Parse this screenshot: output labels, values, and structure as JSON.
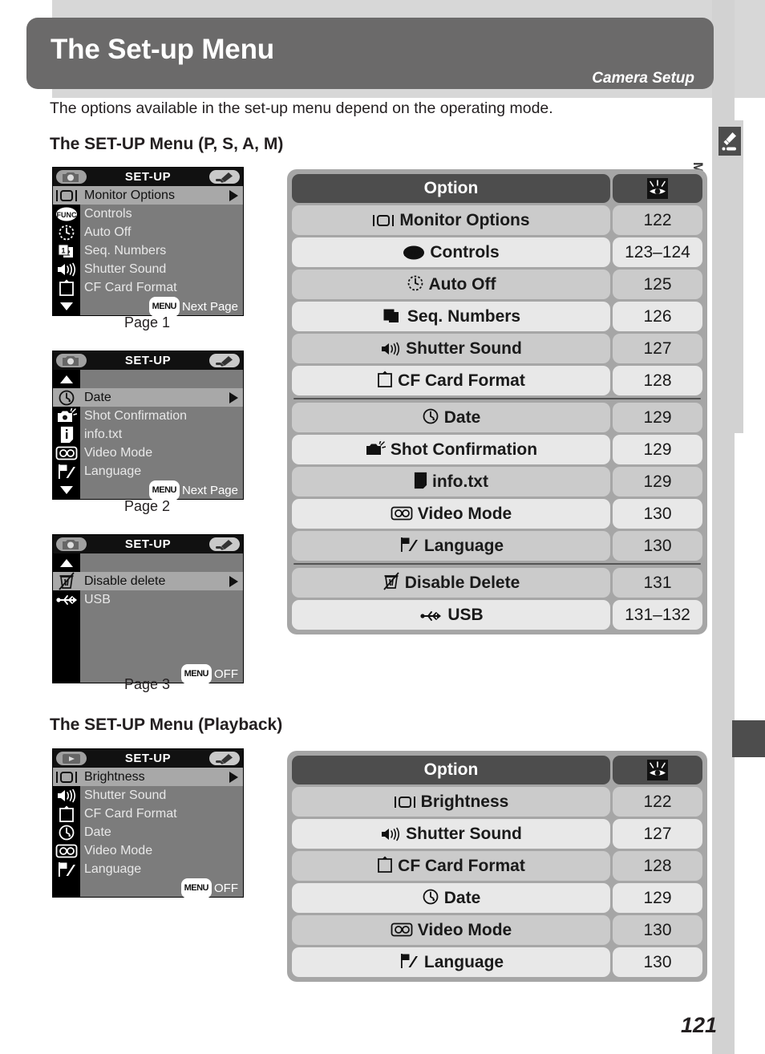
{
  "header": {
    "title": "The Set-up Menu",
    "subtitle": "Camera Setup"
  },
  "intro": "The options available in the set-up menu depend on the operating mode.",
  "sections": [
    {
      "heading": "The SET-UP Menu (P, S, A, M)"
    },
    {
      "heading": "The SET-UP Menu (Playback)"
    }
  ],
  "sidebar": {
    "label": "Menu Guide—The Set-up Menu",
    "icon": "screwdriver-icon"
  },
  "page_number": "121",
  "lcd_screens": [
    {
      "title": "SET-UP",
      "mode_icon": "camera-icon",
      "tool_icon": "screwdriver-icon",
      "caption": "Page 1",
      "has_up_arrow": false,
      "has_down_arrow": true,
      "footer_label": "Next Page",
      "footer_pill": "MENU",
      "rows": [
        {
          "icon": "monitor-icon",
          "label": "Monitor Options",
          "selected": true
        },
        {
          "icon": "func-icon",
          "label": "Controls",
          "selected": false
        },
        {
          "icon": "clock-dashed-icon",
          "label": "Auto Off",
          "selected": false
        },
        {
          "icon": "seq-numbers-icon",
          "label": "Seq. Numbers",
          "selected": false
        },
        {
          "icon": "speaker-icon",
          "label": "Shutter Sound",
          "selected": false
        },
        {
          "icon": "cf-card-icon",
          "label": "CF Card Format",
          "selected": false
        }
      ]
    },
    {
      "title": "SET-UP",
      "mode_icon": "camera-icon",
      "tool_icon": "screwdriver-icon",
      "caption": "Page 2",
      "has_up_arrow": true,
      "has_down_arrow": true,
      "footer_label": "Next Page",
      "footer_pill": "MENU",
      "rows": [
        {
          "icon": "clock-icon",
          "label": "Date",
          "selected": true
        },
        {
          "icon": "shot-confirm-icon",
          "label": "Shot Confirmation",
          "selected": false
        },
        {
          "icon": "info-icon",
          "label": "info.txt",
          "selected": false
        },
        {
          "icon": "video-mode-icon",
          "label": "Video Mode",
          "selected": false
        },
        {
          "icon": "flag-icon",
          "label": "Language",
          "selected": false
        }
      ]
    },
    {
      "title": "SET-UP",
      "mode_icon": "camera-icon",
      "tool_icon": "screwdriver-icon",
      "caption": "Page 3",
      "has_up_arrow": true,
      "has_down_arrow": false,
      "footer_label": "OFF",
      "footer_pill": "MENU",
      "rows": [
        {
          "icon": "trash-disabled-icon",
          "label": "Disable delete",
          "selected": true
        },
        {
          "icon": "usb-icon",
          "label": "USB",
          "selected": false
        }
      ]
    },
    {
      "title": "SET-UP",
      "mode_icon": "playback-icon",
      "tool_icon": "screwdriver-icon",
      "caption": "",
      "has_up_arrow": false,
      "has_down_arrow": false,
      "footer_label": "OFF",
      "footer_pill": "MENU",
      "rows": [
        {
          "icon": "monitor-icon",
          "label": "Brightness",
          "selected": true
        },
        {
          "icon": "speaker-icon",
          "label": "Shutter Sound",
          "selected": false
        },
        {
          "icon": "cf-card-icon",
          "label": "CF Card Format",
          "selected": false
        },
        {
          "icon": "clock-icon",
          "label": "Date",
          "selected": false
        },
        {
          "icon": "video-mode-icon",
          "label": "Video Mode",
          "selected": false
        },
        {
          "icon": "flag-icon",
          "label": "Language",
          "selected": false
        }
      ]
    }
  ],
  "tables": [
    {
      "header": {
        "option": "Option",
        "page_icon": "eye-reference-icon"
      },
      "groups": [
        {
          "rows": [
            {
              "icon": "monitor-icon",
              "label": "Monitor Options",
              "page": "122"
            },
            {
              "icon": "func-icon",
              "label": "Controls",
              "page": "123–124"
            },
            {
              "icon": "clock-dashed-icon",
              "label": "Auto Off",
              "page": "125"
            },
            {
              "icon": "seq-numbers-icon",
              "label": "Seq. Numbers",
              "page": "126"
            },
            {
              "icon": "speaker-icon",
              "label": "Shutter Sound",
              "page": "127"
            },
            {
              "icon": "cf-card-icon",
              "label": "CF Card Format",
              "page": "128"
            }
          ]
        },
        {
          "rows": [
            {
              "icon": "clock-icon",
              "label": "Date",
              "page": "129"
            },
            {
              "icon": "shot-confirm-icon",
              "label": "Shot Confirmation",
              "page": "129"
            },
            {
              "icon": "info-icon",
              "label": "info.txt",
              "page": "129"
            },
            {
              "icon": "video-mode-icon",
              "label": "Video Mode",
              "page": "130"
            },
            {
              "icon": "flag-icon",
              "label": "Language",
              "page": "130"
            }
          ]
        },
        {
          "rows": [
            {
              "icon": "trash-disabled-icon",
              "label": "Disable Delete",
              "page": "131"
            },
            {
              "icon": "usb-icon",
              "label": "USB",
              "page": "131–132"
            }
          ]
        }
      ]
    },
    {
      "header": {
        "option": "Option",
        "page_icon": "eye-reference-icon"
      },
      "groups": [
        {
          "rows": [
            {
              "icon": "monitor-icon",
              "label": "Brightness",
              "page": "122"
            },
            {
              "icon": "speaker-icon",
              "label": "Shutter Sound",
              "page": "127"
            },
            {
              "icon": "cf-card-icon",
              "label": "CF Card Format",
              "page": "128"
            },
            {
              "icon": "clock-icon",
              "label": "Date",
              "page": "129"
            },
            {
              "icon": "video-mode-icon",
              "label": "Video Mode",
              "page": "130"
            },
            {
              "icon": "flag-icon",
              "label": "Language",
              "page": "130"
            }
          ]
        }
      ]
    }
  ],
  "colors": {
    "header_bg": "#6b6a6a",
    "band_gray": "#d7d7d7",
    "table_frame": "#a6a6a6",
    "row_shade": "#cbcbcb",
    "row_light": "#e8e8e8",
    "table_header": "#4d4d4d",
    "lcd_bg": "#7c7c7c",
    "lcd_selected": "#a8a8a8",
    "lcd_black": "#161616"
  }
}
